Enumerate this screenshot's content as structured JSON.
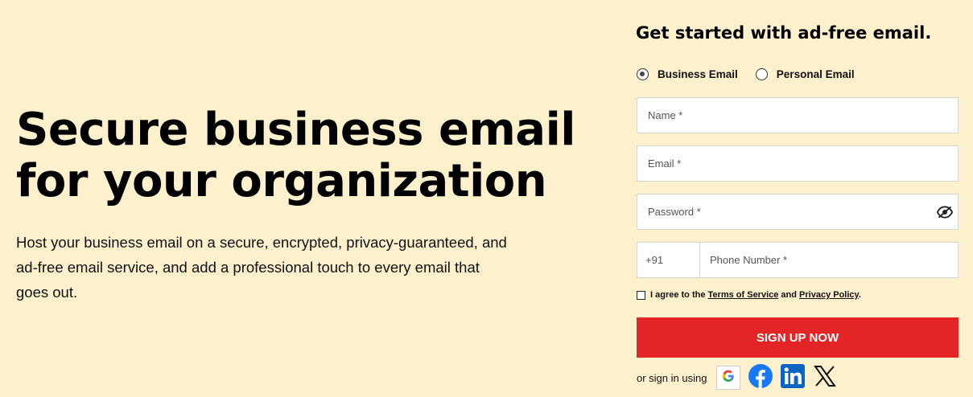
{
  "hero": {
    "title_line1": "Secure business email",
    "title_line2": "for your organization",
    "description": "Host your business email on a secure, encrypted, privacy-guaranteed, and ad-free email service, and add a professional touch to every email that goes out."
  },
  "form": {
    "title": "Get started with ad-free email.",
    "account_types": [
      {
        "label": "Business Email",
        "selected": true
      },
      {
        "label": "Personal Email",
        "selected": false
      }
    ],
    "fields": {
      "name_placeholder": "Name *",
      "email_placeholder": "Email *",
      "password_placeholder": "Password *",
      "country_code": "+91",
      "phone_placeholder": "Phone Number *"
    },
    "agree": {
      "prefix": "I agree to the ",
      "terms": "Terms of Service",
      "and": " and ",
      "privacy": "Privacy Policy",
      "suffix": "."
    },
    "signup_label": "SIGN UP NOW",
    "social": {
      "label": "or sign in using",
      "providers": [
        "google-icon",
        "facebook-icon",
        "linkedin-icon",
        "x-icon"
      ]
    }
  },
  "colors": {
    "background": "#fdf0cd",
    "signup_button": "#e42527",
    "facebook": "#1877f2",
    "linkedin": "#0a66c2"
  }
}
